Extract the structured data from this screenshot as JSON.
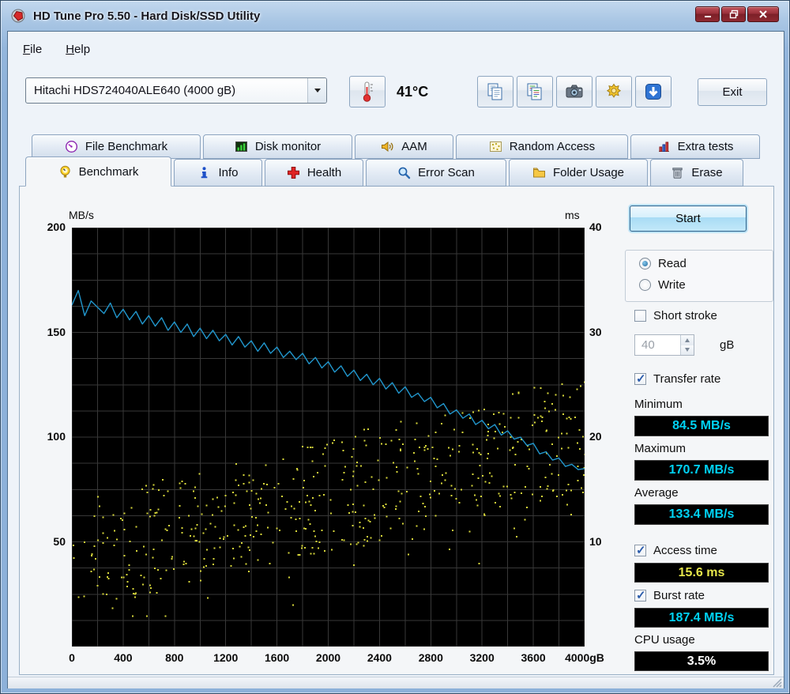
{
  "window": {
    "title": "HD Tune Pro 5.50 - Hard Disk/SSD Utility"
  },
  "menu": {
    "items": [
      {
        "label": "File"
      },
      {
        "label": "Help"
      }
    ]
  },
  "toolbar": {
    "drive_selector": {
      "value": "Hitachi HDS724040ALE640 (4000 gB)"
    },
    "temperature": "41°C",
    "buttons": [
      {
        "name": "copy-text-button",
        "icon": "copy-pages-icon"
      },
      {
        "name": "copy-image-button",
        "icon": "copy-pages-color-icon"
      },
      {
        "name": "screenshot-button",
        "icon": "camera-icon"
      },
      {
        "name": "options-button",
        "icon": "gear-icon"
      },
      {
        "name": "save-button",
        "icon": "download-icon"
      }
    ],
    "exit_label": "Exit"
  },
  "tabs": {
    "active": "Benchmark",
    "row1": [
      {
        "label": "File Benchmark",
        "icon": "gauge-purple-icon"
      },
      {
        "label": "Disk monitor",
        "icon": "green-bars-icon"
      },
      {
        "label": "AAM",
        "icon": "speaker-icon"
      },
      {
        "label": "Random Access",
        "icon": "random-dots-icon"
      },
      {
        "label": "Extra tests",
        "icon": "multi-bars-icon"
      }
    ],
    "row2": [
      {
        "label": "Benchmark",
        "icon": "gauge-yellow-icon"
      },
      {
        "label": "Info",
        "icon": "info-icon"
      },
      {
        "label": "Health",
        "icon": "health-cross-icon"
      },
      {
        "label": "Error Scan",
        "icon": "magnifier-icon"
      },
      {
        "label": "Folder Usage",
        "icon": "folder-icon"
      },
      {
        "label": "Erase",
        "icon": "trash-icon"
      }
    ]
  },
  "benchmark_panel": {
    "start_button": "Start",
    "mode": {
      "read_label": "Read",
      "write_label": "Write",
      "selected": "Read"
    },
    "short_stroke": {
      "label": "Short stroke",
      "checked": false,
      "value": "40",
      "unit": "gB"
    },
    "transfer_rate": {
      "label": "Transfer rate",
      "checked": true
    },
    "minimum": {
      "label": "Minimum",
      "value": "84.5 MB/s"
    },
    "maximum": {
      "label": "Maximum",
      "value": "170.7 MB/s"
    },
    "average": {
      "label": "Average",
      "value": "133.4 MB/s"
    },
    "access_time": {
      "label": "Access time",
      "checked": true,
      "value": "15.6 ms"
    },
    "burst_rate": {
      "label": "Burst rate",
      "checked": true,
      "value": "187.4 MB/s"
    },
    "cpu_usage": {
      "label": "CPU usage",
      "value": "3.5%"
    }
  },
  "colors": {
    "transfer_line": "#2196cc",
    "access_dots": "#d6d63a",
    "value_text_cyan": "#00d2f4",
    "value_text_yellow": "#e4e44a",
    "value_text_white": "#ffffff",
    "plot_background": "#000000",
    "grid": "#383838"
  },
  "chart_data": {
    "type": "line+scatter",
    "axes": {
      "left": {
        "title": "MB/s",
        "range": [
          0,
          200
        ],
        "ticks": [
          200,
          150,
          100,
          50
        ]
      },
      "right": {
        "title": "ms",
        "range": [
          0,
          40
        ],
        "ticks": [
          40,
          30,
          20,
          10
        ]
      },
      "x": {
        "range": [
          0,
          4000
        ],
        "tick_values": [
          0,
          400,
          800,
          1200,
          1600,
          2000,
          2400,
          2800,
          3200,
          3600,
          4000
        ],
        "tick_labels": [
          "0",
          "400",
          "800",
          "1200",
          "1600",
          "2000",
          "2400",
          "2800",
          "3200",
          "3600",
          "4000gB"
        ]
      }
    },
    "grid": {
      "x_divisions": 20,
      "y_divisions": 16
    },
    "series": [
      {
        "name": "Transfer rate",
        "type": "line",
        "unit": "MB/s",
        "color": "#2196cc",
        "x_start": 0,
        "x_step": 50,
        "values": [
          163,
          170,
          158,
          165,
          162,
          159,
          164,
          157,
          161,
          156,
          160,
          154,
          158,
          153,
          157,
          151,
          155,
          150,
          154,
          148,
          152,
          147,
          151,
          146,
          149,
          144,
          148,
          143,
          146,
          141,
          145,
          140,
          143,
          138,
          141,
          137,
          140,
          135,
          138,
          133,
          136,
          131,
          134,
          129,
          132,
          127,
          130,
          125,
          128,
          123,
          126,
          121,
          124,
          119,
          121,
          117,
          119,
          114,
          116,
          111,
          113,
          109,
          111,
          106,
          108,
          104,
          106,
          101,
          103,
          99,
          100,
          96,
          97,
          92,
          93,
          89,
          90,
          86,
          87,
          84.5,
          85
        ]
      },
      {
        "name": "Access time",
        "type": "scatter",
        "unit": "ms",
        "color": "#d6d63a",
        "generated": true,
        "seed": 73,
        "count": 540,
        "x_range": [
          0,
          4000
        ],
        "x_bias_exp": 0.9,
        "band_start_ms": 8.5,
        "band_end_ms": 20.5,
        "spread_ms": 5.5
      }
    ]
  }
}
